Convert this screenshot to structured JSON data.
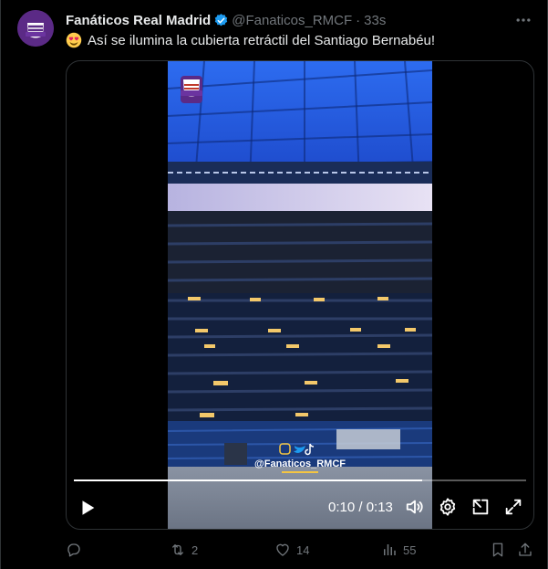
{
  "tweet": {
    "author_name": "Fanáticos Real Madrid",
    "handle": "@Fanaticos_RMCF",
    "separator": "·",
    "time": "33s",
    "text": "Así se ilumina la cubierta retráctil del Santiago Bernabéu!",
    "emoji_icon": "heart-eyes-emoji"
  },
  "video": {
    "watermark_handle": "@Fanaticos_RMCF",
    "time_display": "0:10 / 0:13",
    "progress": 0.77
  },
  "actions": {
    "reply_count": "",
    "retweet_count": "2",
    "like_count": "14",
    "views_count": "55"
  },
  "colors": {
    "background": "#000000",
    "text_primary": "#e7e9ea",
    "text_secondary": "#71767b",
    "verified_blue": "#1d9bf0",
    "border": "#2f3336"
  }
}
